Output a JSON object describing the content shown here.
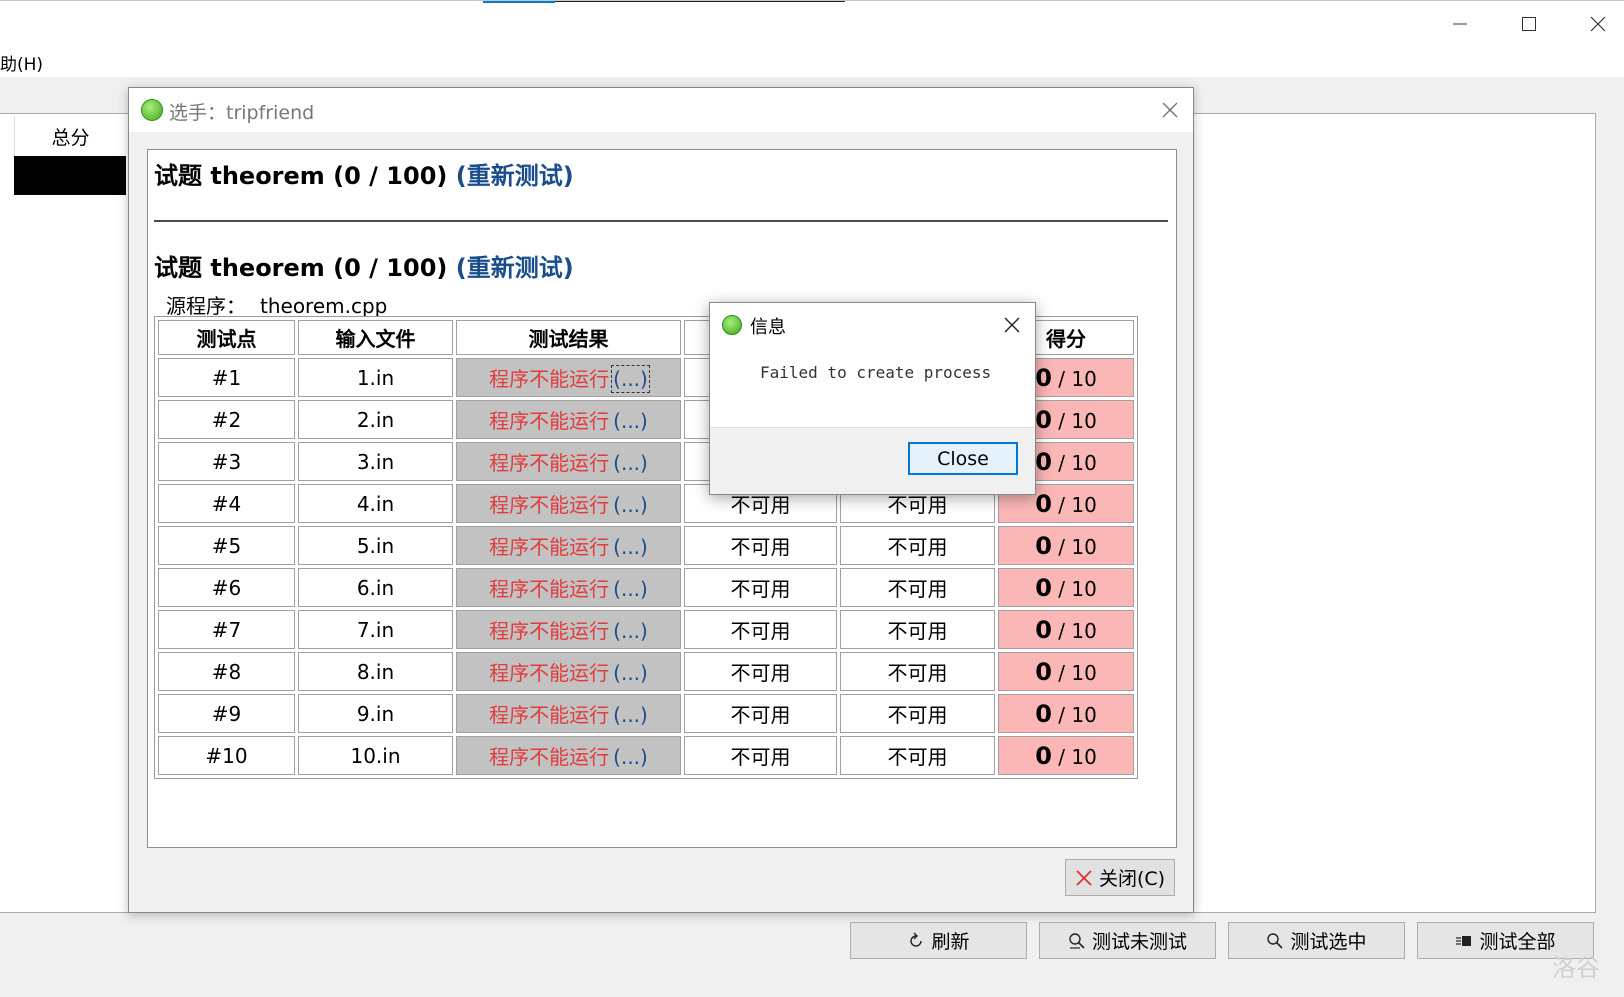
{
  "window": {
    "menu": "助(H)"
  },
  "list": {
    "header": "总分"
  },
  "toolbar": {
    "refresh": "刷新",
    "test_untested": "测试未测试",
    "test_selected": "测试选中",
    "test_all": "测试全部"
  },
  "watermark": "洛谷",
  "dialog": {
    "title": "选手：tripfriend",
    "problems": [
      {
        "title": "试题 theorem (0 / 100)",
        "retest": "(重新测试)"
      },
      {
        "title": "试题 theorem (0 / 100)",
        "retest": "(重新测试)"
      }
    ],
    "source_label": "源程序：",
    "source_value": "theorem.cpp",
    "table": {
      "headers": [
        "测试点",
        "输入文件",
        "测试结果",
        "",
        "",
        "得分"
      ],
      "rows": [
        {
          "id": "#1",
          "input": "1.in",
          "result": "程序不能运行",
          "more": "(...)",
          "col4": "",
          "col5": "",
          "score": "0",
          "full": "/ 10"
        },
        {
          "id": "#2",
          "input": "2.in",
          "result": "程序不能运行",
          "more": "(...)",
          "col4": "",
          "col5": "",
          "score": "0",
          "full": "/ 10"
        },
        {
          "id": "#3",
          "input": "3.in",
          "result": "程序不能运行",
          "more": "(...)",
          "col4": "",
          "col5": "",
          "score": "0",
          "full": "/ 10"
        },
        {
          "id": "#4",
          "input": "4.in",
          "result": "程序不能运行",
          "more": "(...)",
          "col4": "不可用",
          "col5": "不可用",
          "score": "0",
          "full": "/ 10"
        },
        {
          "id": "#5",
          "input": "5.in",
          "result": "程序不能运行",
          "more": "(...)",
          "col4": "不可用",
          "col5": "不可用",
          "score": "0",
          "full": "/ 10"
        },
        {
          "id": "#6",
          "input": "6.in",
          "result": "程序不能运行",
          "more": "(...)",
          "col4": "不可用",
          "col5": "不可用",
          "score": "0",
          "full": "/ 10"
        },
        {
          "id": "#7",
          "input": "7.in",
          "result": "程序不能运行",
          "more": "(...)",
          "col4": "不可用",
          "col5": "不可用",
          "score": "0",
          "full": "/ 10"
        },
        {
          "id": "#8",
          "input": "8.in",
          "result": "程序不能运行",
          "more": "(...)",
          "col4": "不可用",
          "col5": "不可用",
          "score": "0",
          "full": "/ 10"
        },
        {
          "id": "#9",
          "input": "9.in",
          "result": "程序不能运行",
          "more": "(...)",
          "col4": "不可用",
          "col5": "不可用",
          "score": "0",
          "full": "/ 10"
        },
        {
          "id": "#10",
          "input": "10.in",
          "result": "程序不能运行",
          "more": "(...)",
          "col4": "不可用",
          "col5": "不可用",
          "score": "0",
          "full": "/ 10"
        }
      ]
    },
    "close_button": "关闭(C)"
  },
  "message_box": {
    "title": "信息",
    "text": "Failed to create process",
    "close_button": "Close"
  },
  "colors": {
    "accent": "#0078d7",
    "retest_link": "#1a4d8c",
    "error_text": "#e33b3b",
    "score_cell": "#fbb6b6",
    "result_cell": "#c2c2c2"
  }
}
